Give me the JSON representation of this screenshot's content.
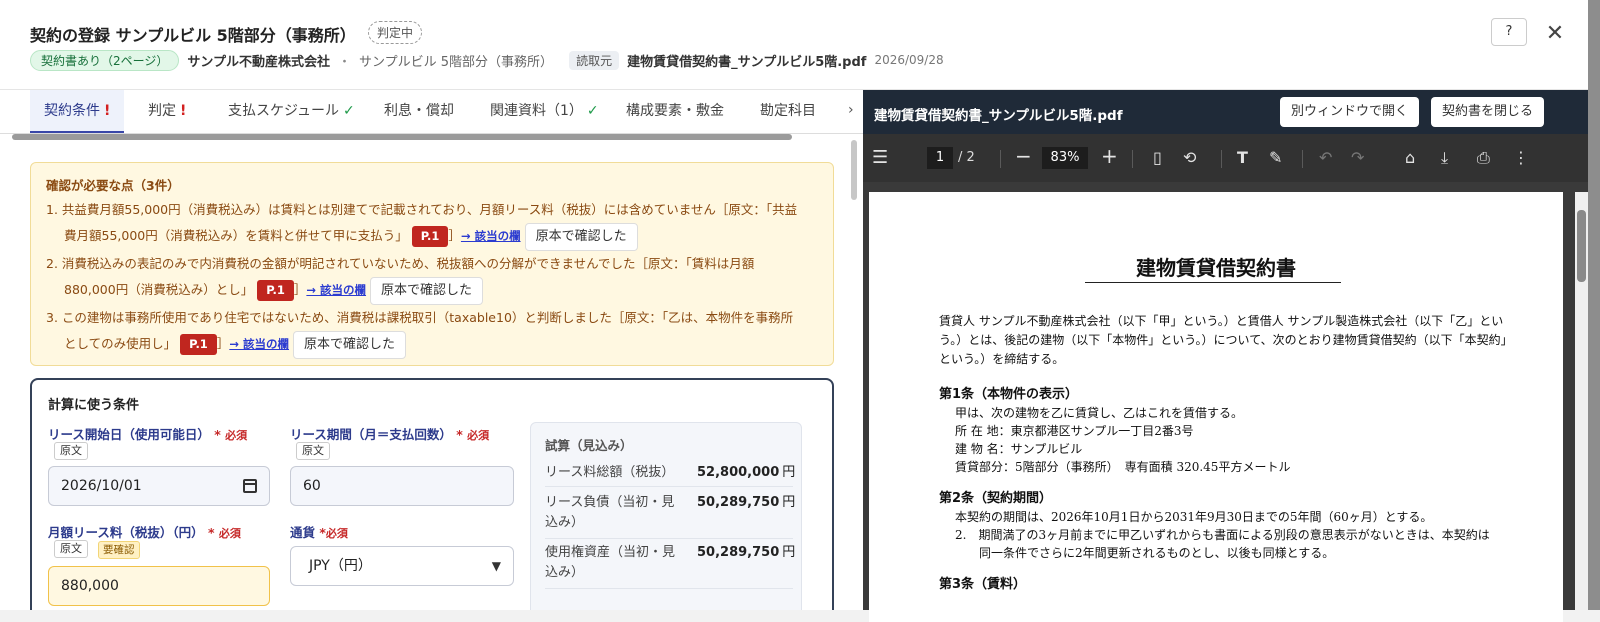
{
  "header": {
    "title": "契約の登録  サンプルビル 5階部分（事務所）",
    "status": "判定中",
    "contract_badge": "契約書あり（2ページ）",
    "company": "サンプル不動産株式会社",
    "separator": "・",
    "property": "サンプルビル 5階部分（事務所）",
    "source_tag": "読取元",
    "pdf_name": "建物賃貸借契約書_サンプルビル5階.pdf",
    "pdf_date": "2026/09/28",
    "help_label": "?",
    "close_label": "✕"
  },
  "tabs": [
    {
      "label": "契約条件",
      "mark": "!"
    },
    {
      "label": "判定",
      "mark": "!"
    },
    {
      "label": "支払スケジュール",
      "mark": "✓"
    },
    {
      "label": "利息・償却",
      "mark": ""
    },
    {
      "label": "関連資料（1）",
      "mark": "✓"
    },
    {
      "label": "構成要素・敷金",
      "mark": ""
    },
    {
      "label": "勘定科目",
      "mark": ""
    }
  ],
  "tabs_more": "›",
  "notice": {
    "heading": "確認が必要な点（3件）",
    "items": [
      {
        "line1": "1. 共益費月額55,000円（消費税込み）は賃料とは別建てで記載されており、月額リース料（税抜）には含めていません［原文：「共益",
        "line2": "費月額55,000円（消費税込み）を賃料と併せて甲に支払う」"
      },
      {
        "line1": "2. 消費税込みの表記のみで内消費税の金額が明記されていないため、税抜額への分解ができませんでした［原文：「賃料は月額",
        "line2": "880,000円（消費税込み）とし」"
      },
      {
        "line1": "3. この建物は事務所使用であり住宅ではないため、消費税は課税取引（taxable10）と判断しました［原文：「乙は、本物件を事務所",
        "line2": "としてのみ使用し」"
      }
    ],
    "page_badge": "P.1",
    "bracket_close": "］",
    "jump_label": "→ 該当の欄",
    "confirm_label": "原本で確認した"
  },
  "calc": {
    "heading": "計算に使う条件",
    "required_label": "必須",
    "star": "*",
    "origin_tag": "原文",
    "check_tag": "要確認",
    "lease_start": {
      "label": "リース開始日（使用可能日）",
      "value": "2026/10/01"
    },
    "lease_term": {
      "label": "リース期間（月＝支払回数）",
      "value": "60"
    },
    "monthly_fee": {
      "label": "月額リース料（税抜）（円）",
      "value": "880,000"
    },
    "currency": {
      "label": "通貨",
      "value": "JPY（円）"
    }
  },
  "trial": {
    "heading": "試算（見込み）",
    "unit": "円",
    "rows": [
      {
        "k": "リース料総額（税抜）",
        "v": "52,800,000"
      },
      {
        "k": "リース負債（当初・見込み）",
        "v": "50,289,750"
      },
      {
        "k": "使用権資産（当初・見込み）",
        "v": "50,289,750"
      }
    ]
  },
  "pdf": {
    "file_name": "建物賃貸借契約書_サンプルビル5階.pdf",
    "open_window": "別ウィンドウで開く",
    "close_doc": "契約書を閉じる",
    "page_current": "1",
    "page_sep": "/",
    "page_total": "2",
    "zoom": "83%",
    "doc_title": "建物賃貸借契約書",
    "intro": "賃貸人 サンプル不動産株式会社（以下「甲」という。）と賃借人 サンプル製造株式会社（以下「乙」という。）とは、後記の建物（以下「本物件」という。）について、次のとおり建物賃貸借契約（以下「本契約」という。）を締結する。",
    "art1": "第1条（本物件の表示）",
    "art1_lines": [
      "甲は、次の建物を乙に賃貸し、乙はこれを賃借する。",
      "所 在 地：東京都港区サンプル一丁目2番3号",
      "建 物 名：サンプルビル",
      "賃貸部分：5階部分（事務所）　専有面積 320.45平方メートル"
    ],
    "art2": "第2条（契約期間）",
    "art2_lines": [
      "本契約の期間は、2026年10月1日から2031年9月30日までの5年間（60ヶ月）とする。",
      "2.　期間満了の3ヶ月前までに甲乙いずれからも書面による別段の意思表示がないときは、本契約は",
      "　　同一条件でさらに2年間更新されるものとし、以後も同様とする。"
    ],
    "art3": "第3条（賃料）"
  }
}
